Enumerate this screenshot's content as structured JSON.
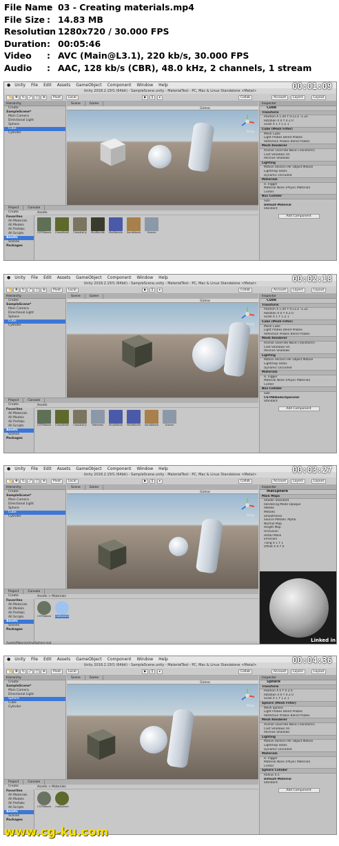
{
  "header": {
    "rows": [
      {
        "key": "File Name",
        "value": "03 - Creating materials.mp4"
      },
      {
        "key": "File Size",
        "value": "14.83 MB"
      },
      {
        "key": "Resolution",
        "value": "1280x720 / 30.000 FPS"
      },
      {
        "key": "Duration",
        "value": "00:05:46"
      },
      {
        "key": "Video",
        "value": "AVC (Main@L3.1), 220 kb/s, 30.000 FPS"
      },
      {
        "key": "Audio",
        "value": "AAC, 128 kb/s (CBR), 48.0 kHz, 2 channels, 1 stream"
      }
    ],
    "colon": ":"
  },
  "menubar": [
    "Unity",
    "File",
    "Edit",
    "Assets",
    "GameObject",
    "Component",
    "Window",
    "Help"
  ],
  "window_title": "Unity 2018.2.15f1 (64bit) - SampleScene.unity - MaterialTest - PC, Mac & Linux Standalone <Metal>",
  "toolbar": {
    "pivot": "Pivot",
    "local": "Local",
    "collab": "Collab",
    "account": "Account",
    "layers": "Layers",
    "layout": "Layout"
  },
  "panels": {
    "hierarchy": "Hierarchy",
    "create": "Create",
    "scene_tab": "Scene",
    "game_tab": "Game",
    "inspector": "Inspector",
    "project": "Project",
    "console": "Console",
    "shaded": "Shaded",
    "gizmos": "Gizmos",
    "persp": "Persp",
    "add_component": "Add Component",
    "linkedin": "Linked in"
  },
  "hierarchy_items": [
    "SampleScene*",
    "Main Camera",
    "Directional Light",
    "Sphere",
    "Cube",
    "Cylinder"
  ],
  "project_tree": [
    "Favorites",
    "All Materials",
    "All Models",
    "All Prefabs",
    "All Scripts",
    "Assets",
    "Scenes",
    "Packages"
  ],
  "frames": [
    {
      "timecode": "00:01:09",
      "hier_selected": "Cube",
      "asset_path": "Assets",
      "assets": [
        "CSTPAlbedo",
        "CrossWindMe",
        "CrossAxiny",
        "MudBundle",
        "MudNetalle",
        "SandAlbedo",
        "Scenes"
      ],
      "asset_colors": [
        "#5f7056",
        "#5e6a2c",
        "#7b7560",
        "#3b3a2e",
        "#4a5aa8",
        "#a8804c",
        "#8b98a8"
      ],
      "inspector": {
        "object": "Cube",
        "sections": [
          "Transform",
          "Cube (Mesh Filter)",
          "Mesh Renderer",
          "Lighting",
          "Materials",
          "Box Collider"
        ],
        "rows": [
          "Position  X 1.44  Y 0.13  Z -1.22",
          "Rotation  X 0  Y 0  Z 0",
          "Scale  X 1  Y 1  Z 1",
          "Mesh  Cube",
          "Light Probes  Blend Probes",
          "Reflection Probes  Blend Probes",
          "Anchor Override  None (Transform)",
          "Cast Shadows  On",
          "Receive Shadows",
          "Motion Vectors  Per Object Motion",
          "Lightmap Static",
          "Dynamic Occluded",
          "Is Trigger",
          "Material  None (Physic Material)",
          "Center",
          "Size"
        ],
        "material": "Default-Material",
        "shader": "Standard"
      }
    },
    {
      "timecode": "00:02:18",
      "hier_selected": "Cube",
      "asset_path": "Assets",
      "assets": [
        "CSTPAlbedo",
        "CrossWindMe",
        "CrossAxiny",
        "Materials",
        "MudAlbedo",
        "MudNetalle",
        "SandAlbedo",
        "Scenes"
      ],
      "asset_colors": [
        "#5f7056",
        "#5e6a2c",
        "#7b7560",
        "#8b98a8",
        "#4a5aa8",
        "#4a5aa8",
        "#a8804c",
        "#8b98a8"
      ],
      "inspector": {
        "object": "Cube",
        "sections": [
          "Transform",
          "Cube (Mesh Filter)",
          "Mesh Renderer",
          "Lighting",
          "Materials",
          "Box Collider"
        ],
        "rows": [
          "Position  X 1.44  Y 0.13  Z -1.22",
          "Rotation  X 0  Y 0  Z 0",
          "Scale  X 1  Y 1  Z 1",
          "Mesh  Cube",
          "Light Probes  Blend Probes",
          "Reflection Probes  Blend Probes",
          "Anchor Override  None (Transform)",
          "Cast Shadows  On",
          "Receive Shadows",
          "Motion Vectors  Per Object Motion",
          "Lightmap Static",
          "Dynamic Occluded",
          "Is Trigger",
          "Material  None (Physic Material)",
          "Center",
          "Size"
        ],
        "material": "CSTPAlbedo/Specular",
        "shader": "Standard"
      }
    },
    {
      "timecode": "00:03:27",
      "hier_selected": "Cube",
      "asset_path": "Assets > Materials",
      "assets": [
        "CSTPAlbedo",
        "matSphere"
      ],
      "asset_colors": [
        "#6a7262",
        "#9fc3ef"
      ],
      "status_path": "Assets/Materials/matSphere.mat",
      "inspector": {
        "object": "matSphere",
        "sections": [
          "Main Maps"
        ],
        "rows": [
          "Shader  Standard",
          "Rendering Mode  Opaque",
          "Albedo",
          "Metallic",
          "Smoothness",
          "Source  Metallic Alpha",
          "Normal Map",
          "Height Map",
          "Occlusion",
          "Detail Mask",
          "Emission",
          "Tiling  X 1  Y 1",
          "Offset  X 0  Y 0"
        ],
        "material": "matSphere",
        "shader": "Standard"
      }
    },
    {
      "timecode": "00:04:36",
      "hier_selected": "Sphere",
      "asset_path": "Assets > Materials",
      "assets": [
        "CSTPAlbedo",
        "matSphere"
      ],
      "asset_colors": [
        "#6a7262",
        "#5e6a2c"
      ],
      "inspector": {
        "object": "Sphere",
        "sections": [
          "Transform",
          "Sphere (Mesh Filter)",
          "Mesh Renderer",
          "Lighting",
          "Materials",
          "Sphere Collider"
        ],
        "rows": [
          "Position  X 0  Y 0  Z 0",
          "Rotation  X 0  Y 0  Z 0",
          "Scale  X 1  Y 1  Z 1",
          "Mesh  Sphere",
          "Light Probes  Blend Probes",
          "Reflection Probes  Blend Probes",
          "Anchor Override  None (Transform)",
          "Cast Shadows  On",
          "Receive Shadows",
          "Motion Vectors  Per Object Motion",
          "Lightmap Static",
          "Dynamic Occluded",
          "Is Trigger",
          "Material  None (Physic Material)",
          "Center",
          "Radius  0.5"
        ],
        "material": "Default-Material",
        "shader": "Standard"
      }
    }
  ],
  "watermark": "www.cg-ku.com",
  "colors": {
    "selection": "#3b77d8",
    "timecode": "#ffffff",
    "watermark": "#f6e200",
    "editor_bg": "#c2c2c2"
  }
}
